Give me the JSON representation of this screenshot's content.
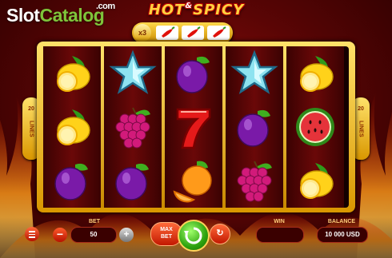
{
  "watermark": {
    "brand_part1": "Slot",
    "brand_part2": "Catalog",
    "domain": ".com"
  },
  "game": {
    "logo_word1": "HOT",
    "logo_amp": "&",
    "logo_word2": "SPICY",
    "multiplier_label": "x3",
    "multiplier_symbols": [
      "chili-pepper-icon",
      "chili-pepper-icon",
      "chili-pepper-icon"
    ]
  },
  "lines_left": {
    "number": "20",
    "word": "LINES"
  },
  "lines_right": {
    "number": "20",
    "word": "LINES"
  },
  "reels": [
    [
      "lemon-icon",
      "lemon-icon",
      "plum-icon"
    ],
    [
      "star-icon",
      "grapes-icon",
      "plum-icon"
    ],
    [
      "plum-icon",
      "seven-icon",
      "orange-icon"
    ],
    [
      "star-icon",
      "plum-icon",
      "grapes-icon"
    ],
    [
      "lemon-icon",
      "watermelon-icon",
      "lemon-icon"
    ]
  ],
  "controls": {
    "bet_label": "BET",
    "bet_value": "50",
    "max_bet_label_1": "MAX",
    "max_bet_label_2": "BET",
    "win_label": "WIN",
    "win_value": "",
    "balance_label": "BALANCE",
    "balance_value": "10 000 USD",
    "minus_label": "−",
    "plus_label": "+",
    "auto_label": "↻"
  },
  "colors": {
    "frame_gold": "#ffd84a",
    "background_red": "#6a0808",
    "spin_green": "#2ea30f"
  }
}
